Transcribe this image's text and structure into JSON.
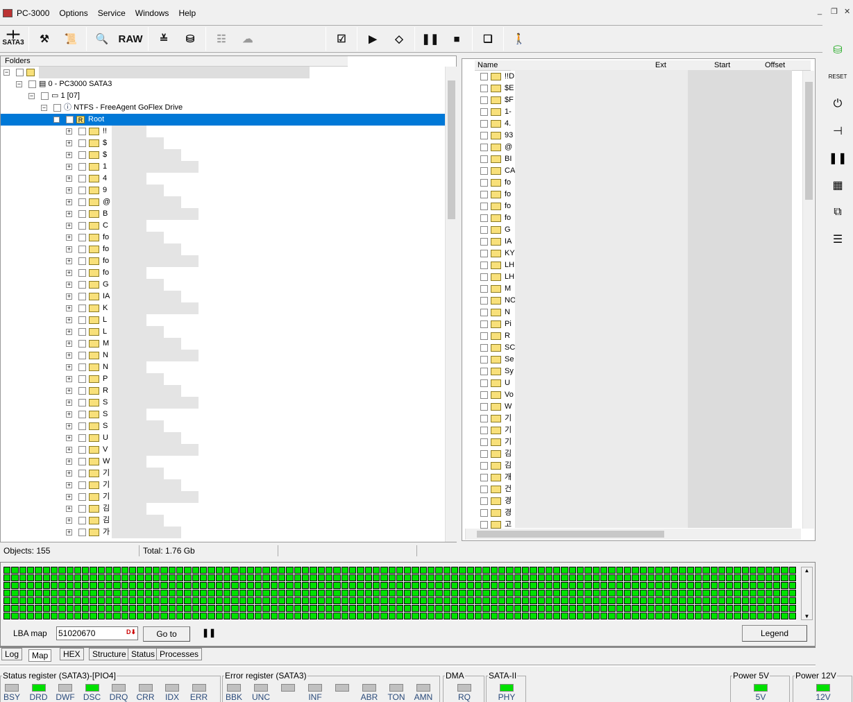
{
  "menu": {
    "app": "PC-3000",
    "items": [
      "Options",
      "Service",
      "Windows",
      "Help"
    ]
  },
  "toolbar": {
    "sata": "SATA3",
    "raw": "RAW"
  },
  "left": {
    "header": "Folders",
    "tree": [
      {
        "label": "0 - PC3000 SATA3"
      },
      {
        "label": "1 [07]"
      },
      {
        "label": "NTFS - FreeAgent GoFlex Drive"
      },
      {
        "label": "Root"
      }
    ],
    "items": [
      "!!",
      "$",
      "$",
      "1",
      "4",
      "9",
      "@",
      "B",
      "C",
      "fo",
      "fo",
      "fo",
      "fo",
      "G",
      "IA",
      "K",
      "L",
      "L",
      "M",
      "N",
      "N",
      "P",
      "R",
      "S",
      "S",
      "S",
      "U",
      "V",
      "W",
      "기",
      "기",
      "기",
      "김",
      "김",
      "가"
    ]
  },
  "right": {
    "columns": [
      "Name",
      "Ext",
      "Start",
      "Offset"
    ],
    "items": [
      "!!D",
      "$E",
      "$F",
      "1-",
      "4.",
      "93",
      "@",
      "BI",
      "CA",
      "fo",
      "fo",
      "fo",
      "fo",
      "G",
      "IA",
      "KY",
      "LH",
      "LH",
      "M",
      "NO",
      "N",
      "Pi",
      "R",
      "SC",
      "Se",
      "Sy",
      "U",
      "Vo",
      "W",
      "기",
      "기",
      "기",
      "김",
      "김",
      "개",
      "건",
      "경",
      "경",
      "고"
    ]
  },
  "status": {
    "objects": "Objects: 155",
    "total": "Total: 1.76 Gb"
  },
  "map": {
    "lba_label": "LBA map",
    "lba_value": "51020670",
    "goto": "Go to",
    "legend": "Legend"
  },
  "tabs": [
    "Log",
    "Map",
    "HEX",
    "Structure",
    "Status",
    "Processes"
  ],
  "registers": {
    "status": {
      "title": "Status register (SATA3)-[PIO4]",
      "bits": [
        {
          "l": "BSY",
          "on": false
        },
        {
          "l": "DRD",
          "on": true
        },
        {
          "l": "DWF",
          "on": false
        },
        {
          "l": "DSC",
          "on": true
        },
        {
          "l": "DRQ",
          "on": false
        },
        {
          "l": "CRR",
          "on": false
        },
        {
          "l": "IDX",
          "on": false
        },
        {
          "l": "ERR",
          "on": false
        }
      ]
    },
    "error": {
      "title": "Error register (SATA3)",
      "bits": [
        {
          "l": "BBK",
          "on": false
        },
        {
          "l": "UNC",
          "on": false
        },
        {
          "l": "",
          "on": false
        },
        {
          "l": "INF",
          "on": false
        },
        {
          "l": "",
          "on": false
        },
        {
          "l": "ABR",
          "on": false
        },
        {
          "l": "TON",
          "on": false
        },
        {
          "l": "AMN",
          "on": false
        }
      ]
    },
    "dma": {
      "title": "DMA",
      "bits": [
        {
          "l": "RQ",
          "on": false
        }
      ]
    },
    "sata": {
      "title": "SATA-II",
      "bits": [
        {
          "l": "PHY",
          "on": true
        }
      ]
    },
    "p5": {
      "title": "Power 5V",
      "bits": [
        {
          "l": "5V",
          "on": true
        }
      ]
    },
    "p12": {
      "title": "Power 12V",
      "bits": [
        {
          "l": "12V",
          "on": true
        }
      ]
    }
  },
  "colors": {
    "selection": "#0078d7",
    "map_ok": "#00e000"
  }
}
